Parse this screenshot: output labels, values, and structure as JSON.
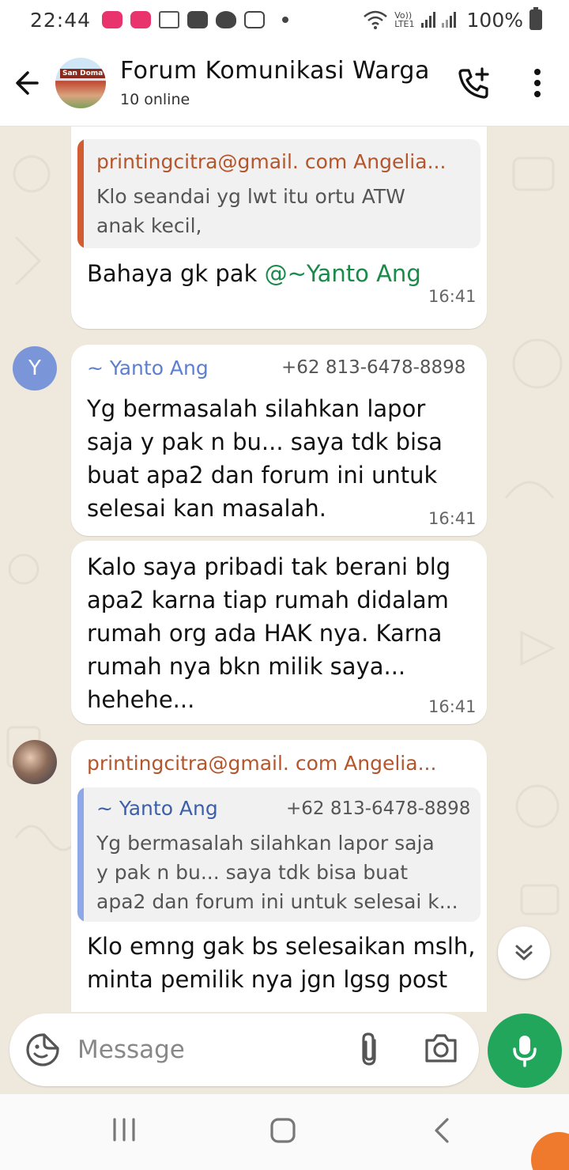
{
  "status_bar": {
    "time": "22:44",
    "network_top": "Vo))",
    "network_bottom": "LTE1",
    "battery": "100%"
  },
  "header": {
    "title": "Forum Komunikasi Warga",
    "subtitle": "10 online",
    "avatar_sign": "San Doma",
    "icons": {
      "back": "arrow-left-icon",
      "call": "add-call-icon",
      "menu": "more-vert-icon"
    }
  },
  "messages": [
    {
      "quote": {
        "author": "printingcitra@gmail. com Angelia...",
        "author_color": "#b5552b",
        "bar_color": "#d35d33",
        "text_lines": [
          "Klo seandai yg lwt itu ortu ATW",
          "anak kecil,"
        ]
      },
      "text_before_mention": "Bahaya gk pak ",
      "mention": "@~Yanto Ang",
      "time": "16:41"
    },
    {
      "avatar_letter": "Y",
      "avatar_color": "#7b96d8",
      "sender": "~ Yanto Ang",
      "sender_color": "#5d7fcf",
      "phone": "+62 813-6478-8898",
      "lines": [
        "Yg bermasalah silahkan lapor",
        "saja y pak n bu... saya tdk bisa",
        "buat apa2 dan forum ini untuk",
        "selesai kan masalah."
      ],
      "time": "16:41"
    },
    {
      "lines": [
        "Kalo saya pribadi tak berani blg",
        "apa2 karna tiap rumah didalam",
        "rumah org ada HAK nya. Karna",
        "rumah nya bkn milik saya...",
        "hehehe..."
      ],
      "time": "16:41"
    },
    {
      "sender": "printingcitra@gmail. com Angelia...",
      "sender_color": "#b5552b",
      "quote": {
        "author": "~ Yanto Ang",
        "author_color": "#3d5ea8",
        "phone": "+62 813-6478-8898",
        "bar_color": "#8fa7e6",
        "text_lines": [
          "Yg bermasalah silahkan lapor saja",
          "y pak n bu... saya tdk bisa buat",
          "apa2 dan forum ini untuk selesai k..."
        ]
      },
      "lines": [
        "Klo emng gak bs selesaikan mslh,",
        "minta pemilik nya jgn lgsg post"
      ]
    }
  ],
  "composer": {
    "placeholder": "Message",
    "icons": {
      "emoji": "sticker-icon",
      "attach": "paperclip-icon",
      "camera": "camera-icon",
      "mic": "mic-icon"
    },
    "accent": "#21a65c"
  },
  "navbar": {
    "icons": {
      "recents": "recents-icon",
      "home": "home-icon",
      "back": "back-icon"
    }
  },
  "colors": {
    "chat_background": "#efe8dd",
    "bubble": "#ffffff",
    "mention": "#1a8a4a"
  }
}
